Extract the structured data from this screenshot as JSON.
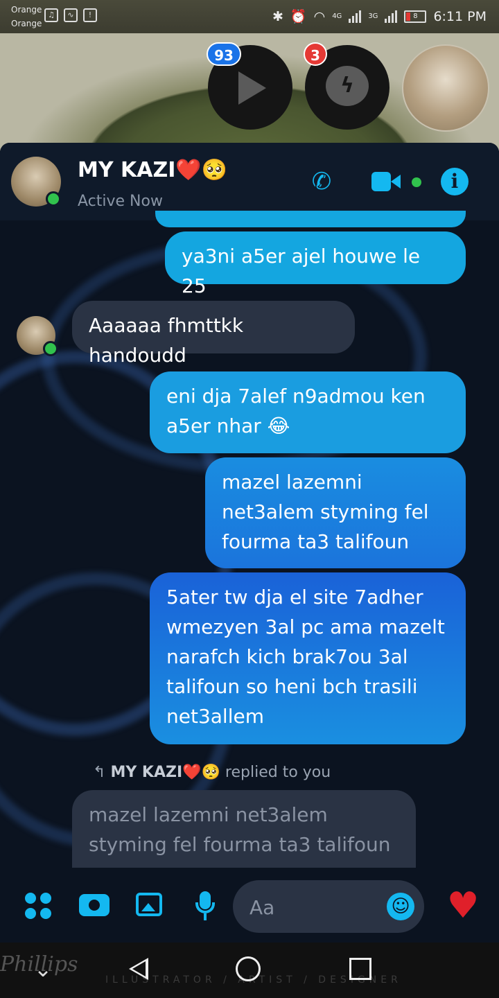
{
  "status_bar": {
    "carrier1": "Orange",
    "carrier2": "Orange",
    "network1": "4G",
    "network2": "3G",
    "battery": "8",
    "time": "6:11 PM"
  },
  "chat_heads": {
    "video_badge": "93",
    "messenger_badge": "3"
  },
  "header": {
    "name": "MY KAZI❤️🥺",
    "status": "Active Now"
  },
  "messages": [
    {
      "from": "me",
      "text": "ya3ni a5er ajel houwe le 25"
    },
    {
      "from": "them",
      "text": "Aaaaaa fhmttkk handoudd"
    },
    {
      "from": "me",
      "text": "eni dja 7alef n9admou ken a5er nhar 😂"
    },
    {
      "from": "me",
      "text": "mazel lazemni net3alem styming fel fourma ta3 talifoun"
    },
    {
      "from": "me",
      "text": "5ater tw dja el site 7adher wmezyen 3al pc ama mazelt narafch kich brak7ou 3al talifoun so heni bch trasili net3allem"
    }
  ],
  "reply": {
    "name": "MY KAZI❤️🥺",
    "suffix": "replied to you",
    "quoted": "mazel lazemni net3alem styming fel fourma ta3 talifoun"
  },
  "composer": {
    "placeholder": "Aa"
  },
  "nav": {
    "watermark": "ILLUSTRATOR / ARTIST / DESIGNER",
    "signature": "Phillips"
  },
  "colors": {
    "accent": "#14b8f0",
    "my_bubble": "#14a6e0",
    "their_bubble": "#2a3344",
    "online": "#31c24d",
    "like_heart": "#e0202a"
  }
}
